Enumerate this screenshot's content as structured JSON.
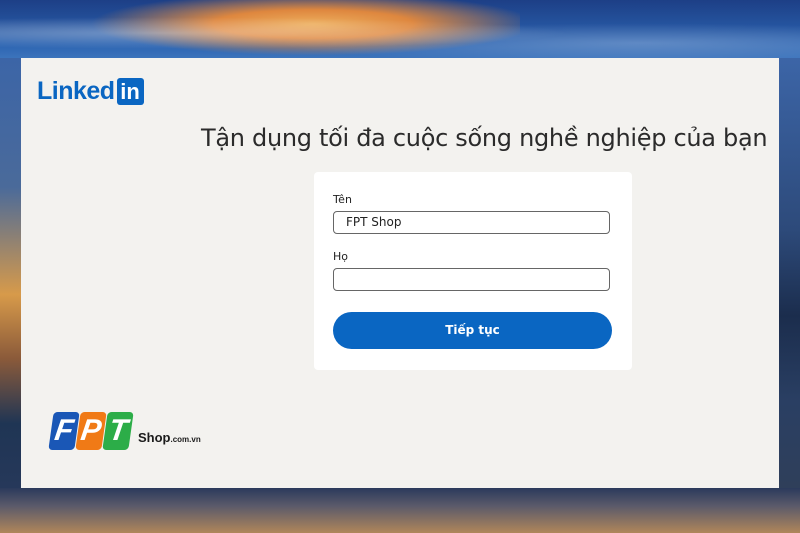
{
  "brand": {
    "logo_text": "Linked",
    "logo_box": "in",
    "accent": "#0a66c2"
  },
  "headline": "Tận dụng tối đa cuộc sống nghề nghiệp của bạn",
  "form": {
    "first_name_label": "Tên",
    "first_name_value": "FPT Shop",
    "last_name_label": "Họ",
    "last_name_value": "",
    "continue_button": "Tiếp tục"
  },
  "watermark": {
    "letters": [
      "F",
      "P",
      "T"
    ],
    "shop": "Shop",
    "domain": ".com.vn",
    "colors": [
      "#1a57b6",
      "#f07a16",
      "#2cad48"
    ]
  }
}
